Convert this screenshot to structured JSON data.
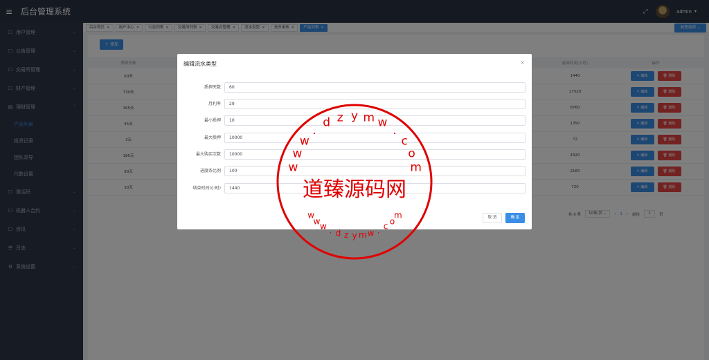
{
  "header": {
    "app_title": "后台管理系统",
    "user_name": "admin"
  },
  "sidebar": {
    "items": [
      {
        "label": "用户管理",
        "icon": "user-icon"
      },
      {
        "label": "公告管理",
        "icon": "notice-icon"
      },
      {
        "label": "交易所管理",
        "icon": "exchange-icon"
      },
      {
        "label": "财产管理",
        "icon": "wallet-icon"
      },
      {
        "label": "理财管理",
        "icon": "finance-icon"
      }
    ],
    "subitems": [
      "产品列表",
      "投资记录",
      "团队领导",
      "代数设置"
    ],
    "items_after": [
      {
        "label": "激活码",
        "icon": "code-icon"
      },
      {
        "label": "机器人合约",
        "icon": "robot-icon"
      },
      {
        "label": "资讯",
        "icon": "news-icon"
      },
      {
        "label": "日志",
        "icon": "log-icon"
      },
      {
        "label": "系统设置",
        "icon": "settings-icon"
      }
    ]
  },
  "tabs": [
    "后台首页",
    "用户中心",
    "公告列表",
    "交易所列表",
    "交易对管理",
    "流水类型",
    "充币审核",
    "产品列表"
  ],
  "active_tab": "产品列表",
  "close_ops_label": "标签选项",
  "add_button_label": "添加",
  "table": {
    "headers": [
      "质押天数",
      "结束时间(小时)",
      "操作"
    ],
    "rows": [
      {
        "days": "60天",
        "hours": "1440"
      },
      {
        "days": "730天",
        "hours": "17520"
      },
      {
        "days": "365天",
        "hours": "8760"
      },
      {
        "days": "45天",
        "hours": "1350"
      },
      {
        "days": "3天",
        "hours": "72"
      },
      {
        "days": "180天",
        "hours": "4320"
      },
      {
        "days": "90天",
        "hours": "2160"
      },
      {
        "days": "30天",
        "hours": "720"
      }
    ],
    "edit_label": "编辑",
    "delete_label": "删除"
  },
  "pagination": {
    "total": "共 8 条",
    "page_size": "10条/页",
    "prev": "‹",
    "current": "1",
    "next": "›",
    "goto_label": "前往",
    "goto_value": "1",
    "page_suffix": "页"
  },
  "modal": {
    "title": "编辑流水类型",
    "fields": [
      {
        "label": "质押天数",
        "value": "60"
      },
      {
        "label": "月利率",
        "value": "29"
      },
      {
        "label": "最小质押",
        "value": "10"
      },
      {
        "label": "最大质押",
        "value": "10000"
      },
      {
        "label": "最大购买次数",
        "value": "10000"
      },
      {
        "label": "进度条比例",
        "value": "100"
      },
      {
        "label": "结束时间(小时)",
        "value": "1440"
      }
    ],
    "cancel_label": "取 消",
    "confirm_label": "确 定"
  },
  "watermark": {
    "center_text": "道臻源码网",
    "ring_text": "www.dzymw.com",
    "color": "#e00000"
  },
  "colors": {
    "primary": "#3a8ee6",
    "danger": "#e64545",
    "sidebar_bg": "#2f3648",
    "header_bg": "#2b3243"
  }
}
